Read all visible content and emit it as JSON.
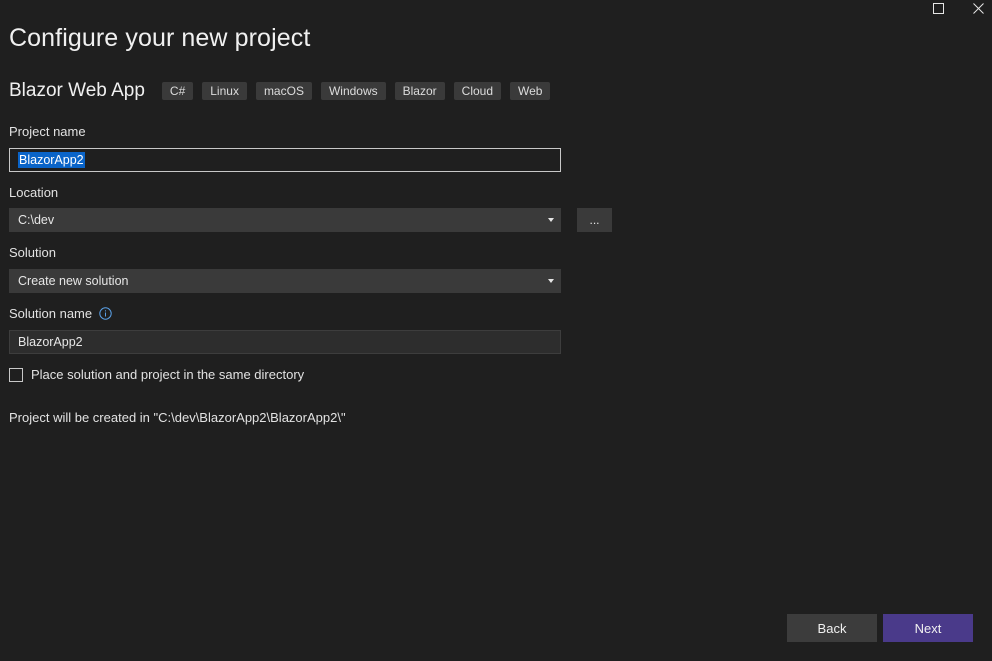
{
  "window": {
    "maximize_icon": "maximize-icon",
    "close_icon": "close-icon"
  },
  "page": {
    "title": "Configure your new project"
  },
  "template": {
    "name": "Blazor Web App",
    "tags": [
      "C#",
      "Linux",
      "macOS",
      "Windows",
      "Blazor",
      "Cloud",
      "Web"
    ]
  },
  "form": {
    "project_name": {
      "label": "Project name",
      "value": "BlazorApp2"
    },
    "location": {
      "label": "Location",
      "value": "C:\\dev",
      "browse_label": "..."
    },
    "solution": {
      "label": "Solution",
      "value": "Create new solution"
    },
    "solution_name": {
      "label": "Solution name",
      "value": "BlazorApp2",
      "info_icon": "info-icon"
    },
    "same_directory": {
      "label": "Place solution and project in the same directory",
      "checked": false
    },
    "path_summary": "Project will be created in \"C:\\dev\\BlazorApp2\\BlazorApp2\\\""
  },
  "footer": {
    "back_label": "Back",
    "next_label": "Next"
  },
  "colors": {
    "background": "#1f1f1f",
    "accent": "#4a3a8a",
    "selection": "#0a64c8"
  }
}
